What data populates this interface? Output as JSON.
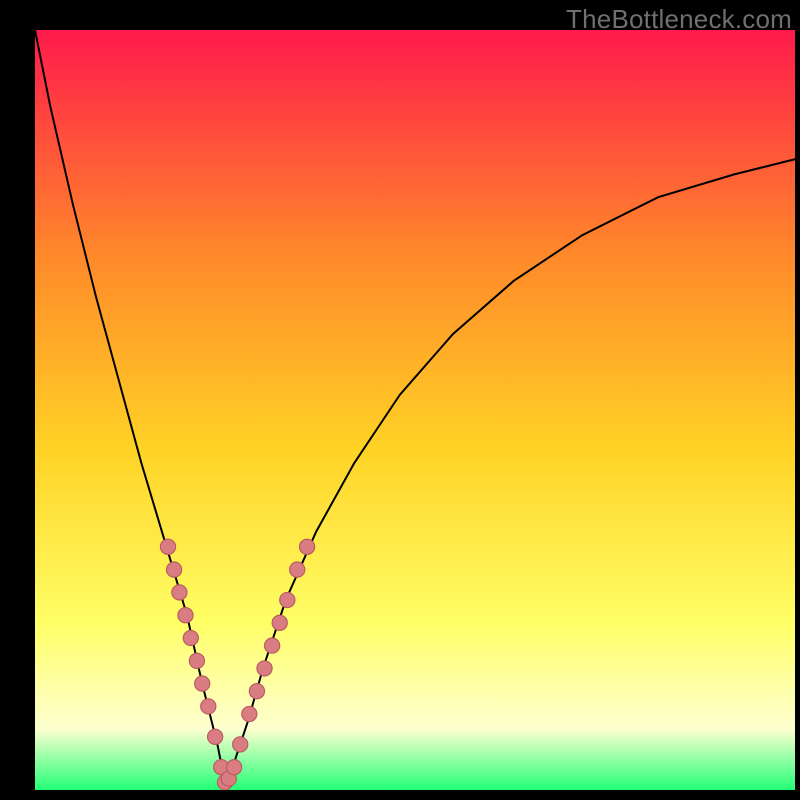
{
  "watermark": "TheBottleneck.com",
  "colors": {
    "frame": "#000000",
    "grad_top": "#ff1a4b",
    "grad_upper_mid": "#ff8a2a",
    "grad_mid": "#ffd225",
    "grad_lower_mid": "#ffff66",
    "grad_pale": "#fdffd0",
    "grad_bottom": "#22ff77",
    "curve": "#000000",
    "bead_fill": "#d97d83",
    "bead_stroke": "#b85a60"
  },
  "chart_data": {
    "type": "line",
    "title": "",
    "xlabel": "",
    "ylabel": "",
    "xlim": [
      0,
      100
    ],
    "ylim": [
      0,
      100
    ],
    "notes": "No axis ticks or labels visible; percentages estimated from shape. Single V-shaped curve with minimum near x≈25. Pink bead markers cluster where curve passes through the lower yellow-to-green band and along the trough.",
    "series": [
      {
        "name": "curve",
        "x": [
          0,
          2,
          5,
          8,
          11,
          14,
          17,
          20,
          22,
          24,
          25,
          26,
          28,
          30,
          33,
          37,
          42,
          48,
          55,
          63,
          72,
          82,
          92,
          100
        ],
        "values": [
          100,
          90,
          77,
          65,
          54,
          43,
          33,
          23,
          14,
          6,
          1,
          3,
          9,
          16,
          25,
          34,
          43,
          52,
          60,
          67,
          73,
          78,
          81,
          83
        ]
      }
    ],
    "markers": [
      {
        "name": "beads",
        "x": [
          17.5,
          18.3,
          19.0,
          19.8,
          20.5,
          21.3,
          22.0,
          22.8,
          23.7,
          24.5,
          25.0,
          25.5,
          26.2,
          27.0,
          28.2,
          29.2,
          30.2,
          31.2,
          32.2,
          33.2,
          34.5,
          35.8
        ],
        "y": [
          32,
          29,
          26,
          23,
          20,
          17,
          14,
          11,
          7,
          3,
          1,
          1.5,
          3,
          6,
          10,
          13,
          16,
          19,
          22,
          25,
          29,
          32
        ]
      }
    ]
  }
}
